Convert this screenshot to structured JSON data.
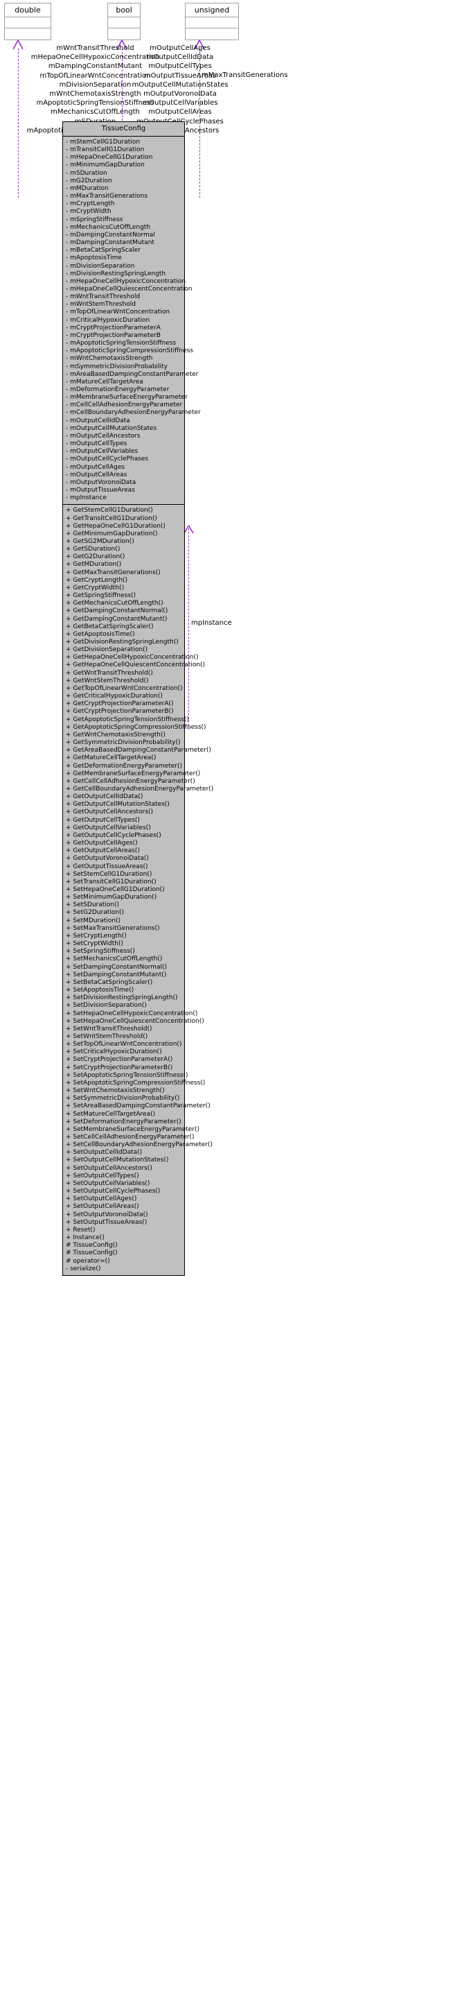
{
  "diagram": {
    "kind": "uml-class-diagram",
    "edge_color": "#9a32cd",
    "class_fill": "#c0c0c0",
    "type_box_border": "#a0a0a0"
  },
  "type_boxes": [
    {
      "name": "double"
    },
    {
      "name": "bool"
    },
    {
      "name": "unsigned"
    }
  ],
  "edge_labels": {
    "double": [
      "mWntTransitThreshold",
      "mHepaOneCellHypoxicConcentration",
      "mDampingConstantMutant",
      "mTopOfLinearWntConcentration",
      "mDivisionSeparation",
      "mWntChemotaxisStrength",
      "mApoptoticSpringTensionStiffness",
      "mMechanicsCutOffLength",
      "mSDuration",
      "mApoptoticSpringCompressionStiffness",
      "..."
    ],
    "bool": [
      "mOutputCellAges",
      "mOutputCellIdData",
      "mOutputCellTypes",
      "mOutputTissueAreas",
      "mOutputCellMutationStates",
      "mOutputVoronoiData",
      "mOutputCellVariables",
      "mOutputCellAreas",
      "mOutputCellCyclePhases",
      "mOutputCellAncestors",
      "..."
    ],
    "unsigned": [
      "mMaxTransitGenerations"
    ]
  },
  "uml_class": {
    "name": "TissueConfig",
    "attributes": [
      "- mStemCellG1Duration",
      "- mTransitCellG1Duration",
      "- mHepaOneCellG1Duration",
      "- mMinimumGapDuration",
      "- mSDuration",
      "- mG2Duration",
      "- mMDuration",
      "- mMaxTransitGenerations",
      "- mCryptLength",
      "- mCryptWidth",
      "- mSpringStiffness",
      "- mMechanicsCutOffLength",
      "- mDampingConstantNormal",
      "- mDampingConstantMutant",
      "- mBetaCatSpringScaler",
      "- mApoptosisTime",
      "- mDivisionSeparation",
      "- mDivisionRestingSpringLength",
      "- mHepaOneCellHypoxicConcentration",
      "- mHepaOneCellQuiescentConcentration",
      "- mWntTransitThreshold",
      "- mWntStemThreshold",
      "- mTopOfLinearWntConcentration",
      "- mCriticalHypoxicDuration",
      "- mCryptProjectionParameterA",
      "- mCryptProjectionParameterB",
      "- mApoptoticSpringTensionStiffness",
      "- mApoptoticSpringCompressionStiffness",
      "- mWntChemotaxisStrength",
      "- mSymmetricDivisionProbability",
      "- mAreaBasedDampingConstantParameter",
      "- mMatureCellTargetArea",
      "- mDeformationEnergyParameter",
      "- mMembraneSurfaceEnergyParameter",
      "- mCellCellAdhesionEnergyParameter",
      "- mCellBoundaryAdhesionEnergyParameter",
      "- mOutputCellIdData",
      "- mOutputCellMutationStates",
      "- mOutputCellAncestors",
      "- mOutputCellTypes",
      "- mOutputCellVariables",
      "- mOutputCellCyclePhases",
      "- mOutputCellAges",
      "- mOutputCellAreas",
      "- mOutputVoronoiData",
      "- mOutputTissueAreas",
      "- mpInstance"
    ],
    "operations": [
      "+ GetStemCellG1Duration()",
      "+ GetTransitCellG1Duration()",
      "+ GetHepaOneCellG1Duration()",
      "+ GetMinimumGapDuration()",
      "+ GetSG2MDuration()",
      "+ GetSDuration()",
      "+ GetG2Duration()",
      "+ GetMDuration()",
      "+ GetMaxTransitGenerations()",
      "+ GetCryptLength()",
      "+ GetCryptWidth()",
      "+ GetSpringStiffness()",
      "+ GetMechanicsCutOffLength()",
      "+ GetDampingConstantNormal()",
      "+ GetDampingConstantMutant()",
      "+ GetBetaCatSpringScaler()",
      "+ GetApoptosisTime()",
      "+ GetDivisionRestingSpringLength()",
      "+ GetDivisionSeparation()",
      "+ GetHepaOneCellHypoxicConcentration()",
      "+ GetHepaOneCellQuiescentConcentration()",
      "+ GetWntTransitThreshold()",
      "+ GetWntStemThreshold()",
      "+ GetTopOfLinearWntConcentration()",
      "+ GetCriticalHypoxicDuration()",
      "+ GetCryptProjectionParameterA()",
      "+ GetCryptProjectionParameterB()",
      "+ GetApoptoticSpringTensionStiffness()",
      "+ GetApoptoticSpringCompressionStiffness()",
      "+ GetWntChemotaxisStrength()",
      "+ GetSymmetricDivisionProbability()",
      "+ GetAreaBasedDampingConstantParameter()",
      "+ GetMatureCellTargetArea()",
      "+ GetDeformationEnergyParameter()",
      "+ GetMembraneSurfaceEnergyParameter()",
      "+ GetCellCellAdhesionEnergyParameter()",
      "+ GetCellBoundaryAdhesionEnergyParameter()",
      "+ GetOutputCellIdData()",
      "+ GetOutputCellMutationStates()",
      "+ GetOutputCellAncestors()",
      "+ GetOutputCellTypes()",
      "+ GetOutputCellVariables()",
      "+ GetOutputCellCyclePhases()",
      "+ GetOutputCellAges()",
      "+ GetOutputCellAreas()",
      "+ GetOutputVoronoiData()",
      "+ GetOutputTissueAreas()",
      "+ SetStemCellG1Duration()",
      "+ SetTransitCellG1Duration()",
      "+ SetHepaOneCellG1Duration()",
      "+ SetMinimumGapDuration()",
      "+ SetSDuration()",
      "+ SetG2Duration()",
      "+ SetMDuration()",
      "+ SetMaxTransitGenerations()",
      "+ SetCryptLength()",
      "+ SetCryptWidth()",
      "+ SetSpringStiffness()",
      "+ SetMechanicsCutOffLength()",
      "+ SetDampingConstantNormal()",
      "+ SetDampingConstantMutant()",
      "+ SetBetaCatSpringScaler()",
      "+ SetApoptosisTime()",
      "+ SetDivisionRestingSpringLength()",
      "+ SetDivisionSeparation()",
      "+ SetHepaOneCellHypoxicConcentration()",
      "+ SetHepaOneCellQuiescentConcentration()",
      "+ SetWntTransitThreshold()",
      "+ SetWntStemThreshold()",
      "+ SetTopOfLinearWntConcentration()",
      "+ SetCriticalHypoxicDuration()",
      "+ SetCryptProjectionParameterA()",
      "+ SetCryptProjectionParameterB()",
      "+ SetApoptoticSpringTensionStiffness()",
      "+ SetApoptoticSpringCompressionStiffness()",
      "+ SetWntChemotaxisStrength()",
      "+ SetSymmetricDivisionProbability()",
      "+ SetAreaBasedDampingConstantParameter()",
      "+ SetMatureCellTargetArea()",
      "+ SetDeformationEnergyParameter()",
      "+ SetMembraneSurfaceEnergyParameter()",
      "+ SetCellCellAdhesionEnergyParameter()",
      "+ SetCellBoundaryAdhesionEnergyParameter()",
      "+ SetOutputCellIdData()",
      "+ SetOutputCellMutationStates()",
      "+ SetOutputCellAncestors()",
      "+ SetOutputCellTypes()",
      "+ SetOutputCellVariables()",
      "+ SetOutputCellCyclePhases()",
      "+ SetOutputCellAges()",
      "+ SetOutputCellAreas()",
      "+ SetOutputVoronoiData()",
      "+ SetOutputTissueAreas()",
      "+ Reset()",
      "+ Instance()",
      "# TissueConfig()",
      "# TissueConfig()",
      "# operator=()",
      "- serialize()"
    ]
  },
  "side_labels": {
    "mp_instance": "mpInstance"
  }
}
